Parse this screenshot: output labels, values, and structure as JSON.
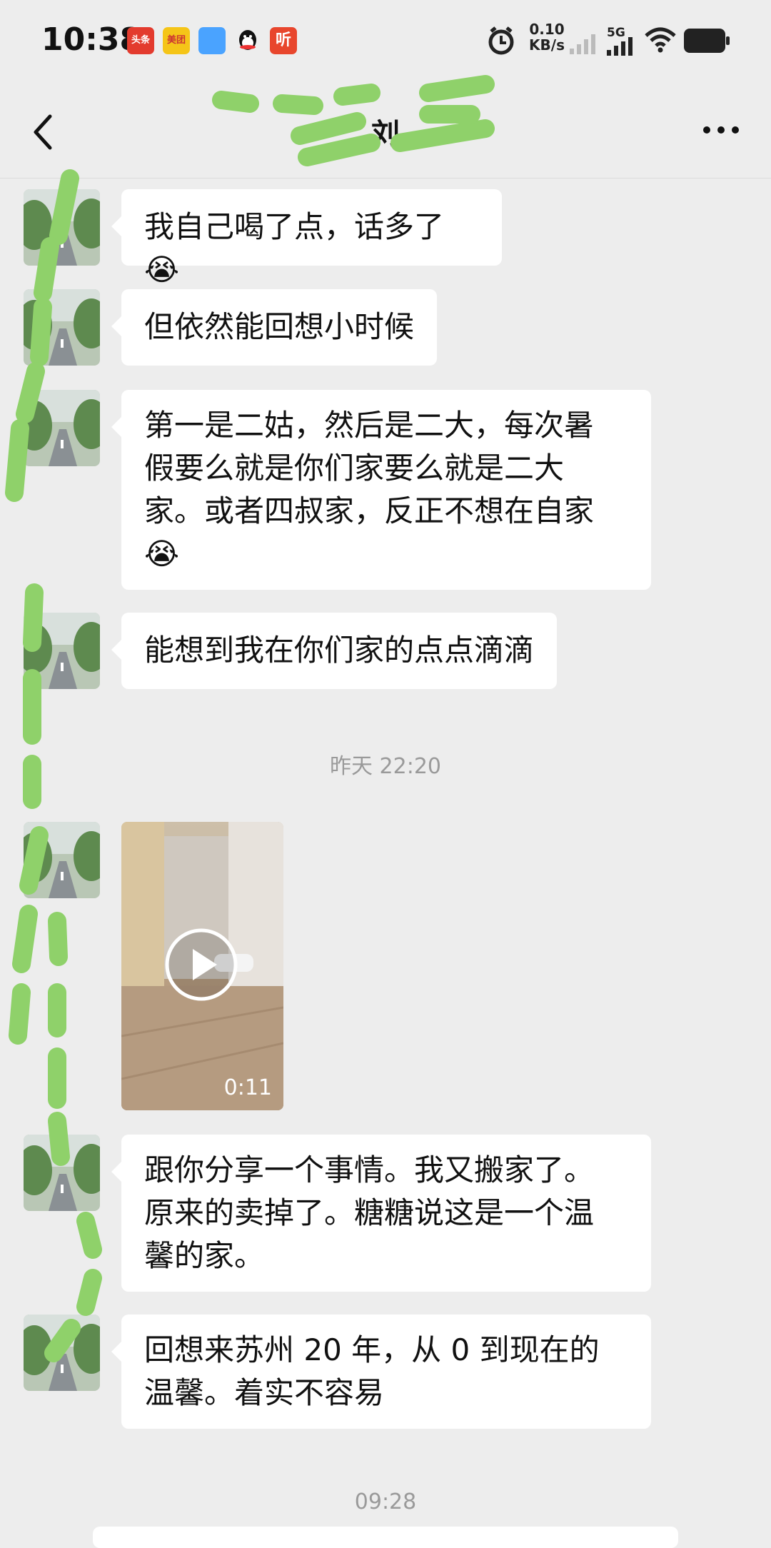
{
  "status_bar": {
    "time": "10:38",
    "app_icons": [
      {
        "name": "toutiao-app-icon",
        "label": "头条",
        "color": "#e33b2e"
      },
      {
        "name": "meituan-app-icon",
        "label": "美团",
        "color": "#f5c518"
      },
      {
        "name": "files-app-icon",
        "label": "",
        "color": "#4aa3ff"
      },
      {
        "name": "qq-app-icon",
        "label": "",
        "color": "#ffffff"
      },
      {
        "name": "ting-app-icon",
        "label": "听",
        "color": "#e8462d"
      }
    ],
    "network_speed_value": "0.10",
    "network_speed_unit": "KB/s",
    "network_type": "5G"
  },
  "nav": {
    "title": "刘"
  },
  "messages": [
    {
      "type": "text",
      "text": "我自己喝了点，话多了😭"
    },
    {
      "type": "text",
      "text": "但依然能回想小时候"
    },
    {
      "type": "text",
      "text": "第一是二姑，然后是二大，每次暑\n假要么就是你们家要么就是二大\n家。或者四叔家，反正不想在自家\n😭"
    },
    {
      "type": "text",
      "text": "能想到我在你们家的点点滴滴"
    },
    {
      "type": "timestamp",
      "text": "昨天 22:20"
    },
    {
      "type": "video",
      "duration": "0:11"
    },
    {
      "type": "text",
      "text": "跟你分享一个事情。我又搬家了。\n原来的卖掉了。糖糖说这是一个温\n馨的家。"
    },
    {
      "type": "text",
      "text": "回想来苏州 20 年，从 0 到现在的\n温馨。着实不容易"
    },
    {
      "type": "timestamp",
      "text": "09:28"
    }
  ],
  "colors": {
    "background": "#ededed",
    "bubble": "#ffffff",
    "timestamp_text": "#9a9a9a",
    "scribble": "#8fd16a"
  }
}
